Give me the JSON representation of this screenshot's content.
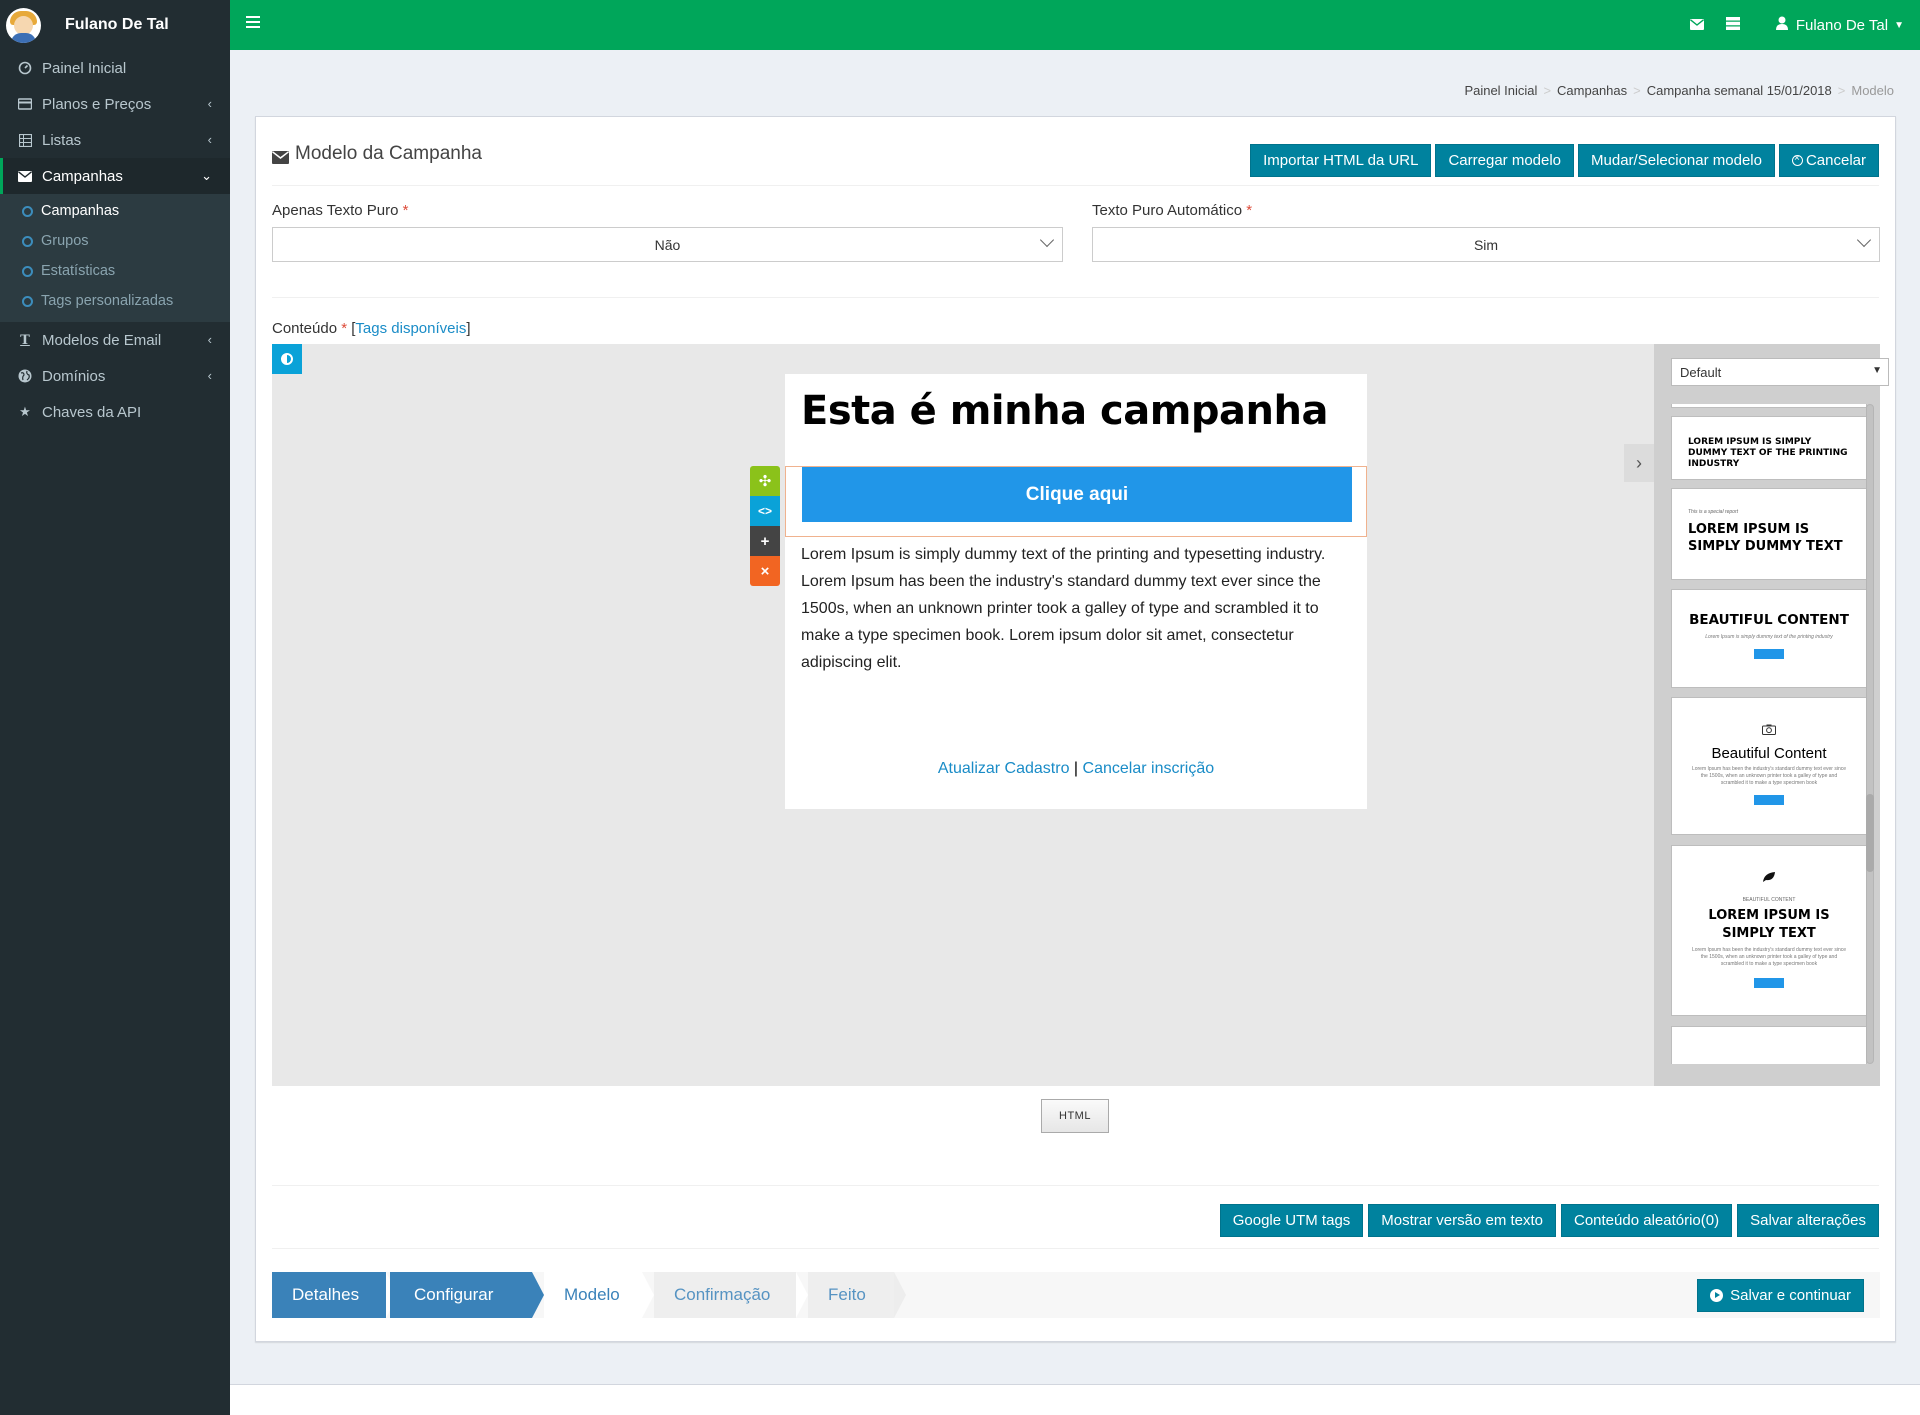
{
  "sidebar": {
    "user_name": "Fulano De Tal",
    "items": [
      {
        "label": "Painel Inicial",
        "icon": "dashboard-icon"
      },
      {
        "label": "Planos e Preços",
        "icon": "credit-card-icon"
      },
      {
        "label": "Listas",
        "icon": "table-icon"
      },
      {
        "label": "Campanhas",
        "icon": "envelope-icon"
      },
      {
        "label": "Modelos de Email",
        "icon": "text-format-icon"
      },
      {
        "label": "Domínios",
        "icon": "globe-icon"
      },
      {
        "label": "Chaves da API",
        "icon": "star-icon"
      }
    ],
    "sub_items": [
      "Campanhas",
      "Grupos",
      "Estatísticas",
      "Tags personalizadas"
    ]
  },
  "topbar": {
    "user_name": "Fulano De Tal"
  },
  "breadcrumb": [
    "Painel Inicial",
    "Campanhas",
    "Campanha semanal 15/01/2018",
    "Modelo"
  ],
  "box": {
    "title": "Modelo da Campanha",
    "buttons": [
      "Importar HTML da URL",
      "Carregar modelo",
      "Mudar/Selecionar modelo",
      "Cancelar"
    ]
  },
  "form": {
    "plain_text_label": "Apenas Texto Puro",
    "plain_text_value": "Não",
    "auto_plain_label": "Texto Puro Automático",
    "auto_plain_value": "Sim",
    "required_mark": "*",
    "content_label": "Conteúdo",
    "tags_link": "Tags disponíveis",
    "bracket_open": "[",
    "bracket_close": "]"
  },
  "email": {
    "heading": "Esta é minha campanha",
    "cta": "Clique aqui",
    "body": "Lorem Ipsum is simply dummy text of the printing and typesetting industry. Lorem Ipsum has been the industry's standard dummy text ever since the 1500s, when an unknown printer took a galley of type and scrambled it to make a type specimen book. Lorem ipsum dolor sit amet, consectetur adipiscing elit.",
    "link_update": "Atualizar Cadastro",
    "separator": "|",
    "link_unsubscribe": "Cancelar inscrição"
  },
  "block_tools": {
    "move": "✣",
    "code": "<>",
    "add": "+",
    "delete": "×"
  },
  "panel": {
    "select_value": "Default",
    "thumbs": [
      {
        "title": "LOREM IPSUM IS SIMPLY DUMMY TEXT OF THE PRINTING INDUSTRY"
      },
      {
        "kicker": "This is a special report",
        "title": "LOREM IPSUM IS SIMPLY DUMMY TEXT"
      },
      {
        "title": "BEAUTIFUL CONTENT",
        "sub": "Lorem Ipsum is simply dummy text of the printing industry"
      },
      {
        "title": "Beautiful Content",
        "sub": "Lorem Ipsum has been the industry's standard dummy text ever since the 1500s, when an unknown printer took a galley of type and scrambled it to make a type specimen book"
      },
      {
        "kicker": "BEAUTIFUL CONTENT",
        "title": "LOREM IPSUM IS SIMPLY TEXT",
        "sub": "Lorem Ipsum has been the industry's standard dummy text ever since the 1500s, when an unknown printer took a galley of type and scrambled it to make a type specimen book"
      }
    ]
  },
  "html_button": "HTML",
  "bottom_buttons": [
    "Google UTM tags",
    "Mostrar versão em texto",
    "Conteúdo aleatório(0)",
    "Salvar alterações"
  ],
  "wizard": {
    "steps": [
      "Detalhes",
      "Configurar",
      "Modelo",
      "Confirmação",
      "Feito"
    ],
    "save_continue": "Salvar e continuar"
  },
  "colors": {
    "topbar": "#00a65a",
    "sidebar": "#222d32",
    "primary_button": "#00829e",
    "cta": "#2196e8",
    "wizard_done": "#3a82b9"
  }
}
